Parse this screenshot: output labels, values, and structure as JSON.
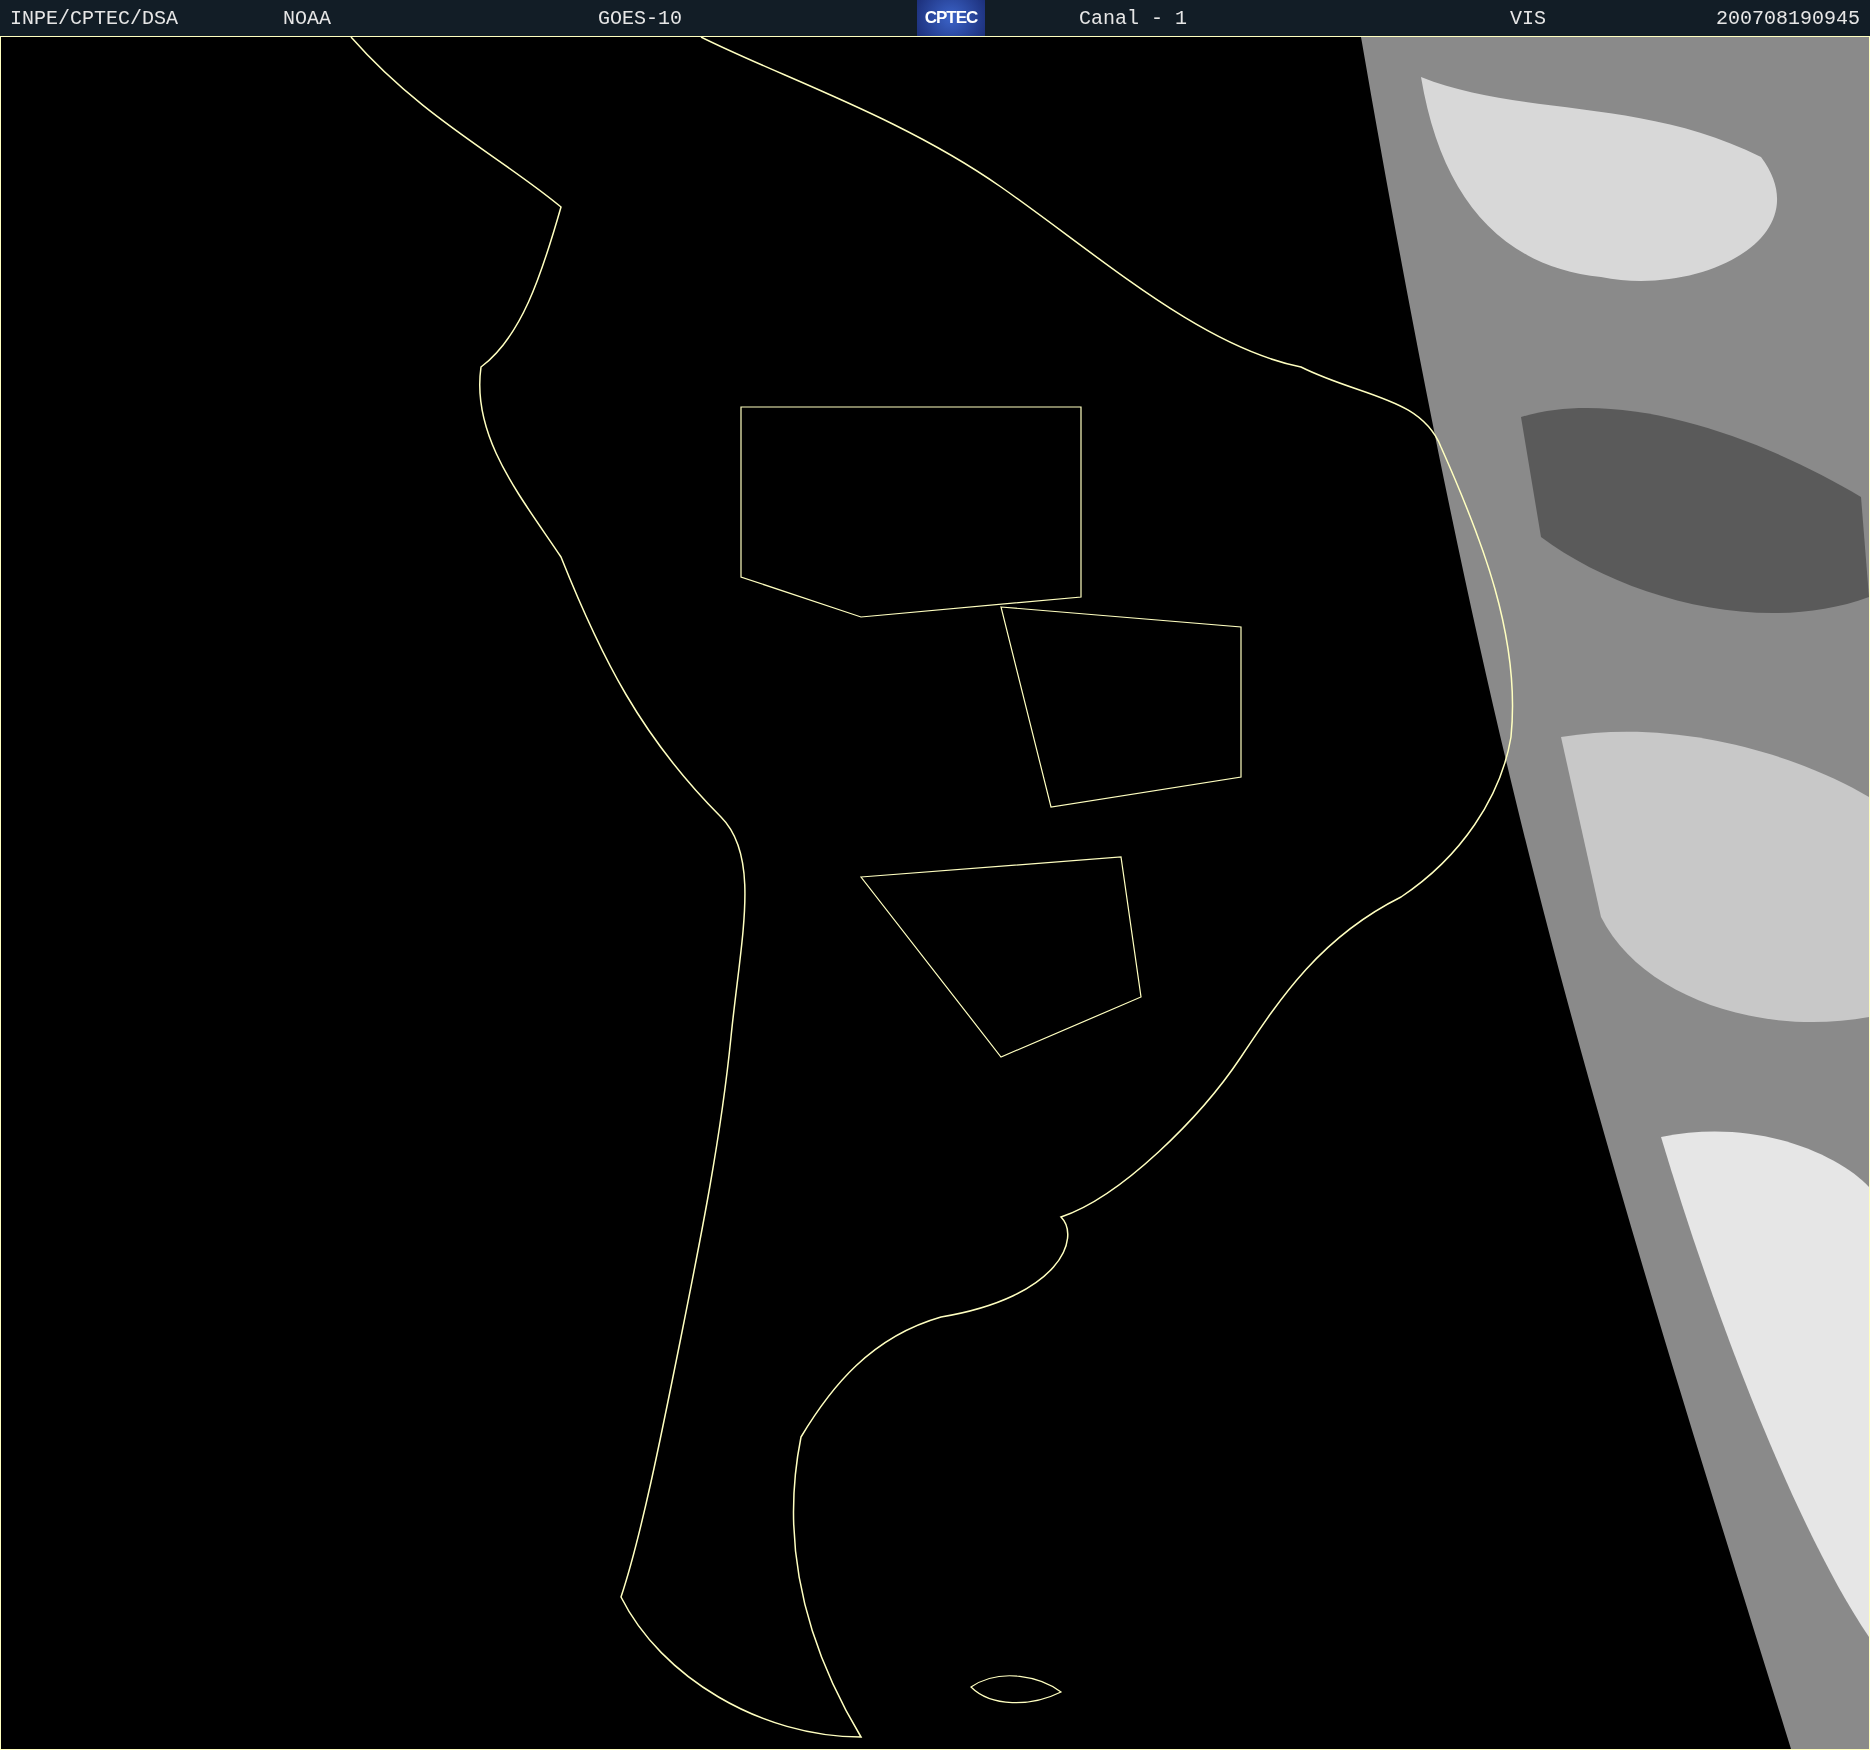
{
  "header": {
    "source": "INPE/CPTEC/DSA",
    "agency": "NOAA",
    "satellite": "GOES-10",
    "logo": "CPTEC",
    "channel": "Canal - 1",
    "band": "VIS",
    "timestamp": "200708190945"
  }
}
